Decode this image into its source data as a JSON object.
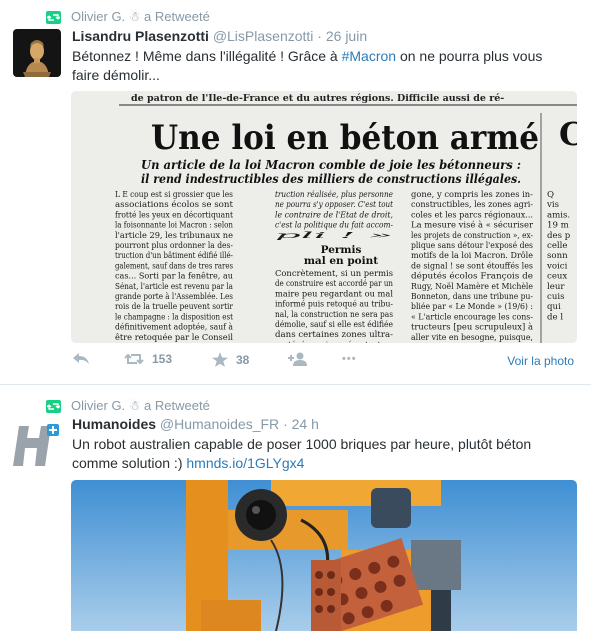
{
  "tweets": [
    {
      "retweet_by": "Olivier G. ☃ a Retweeté",
      "fullname": "Lisandru Plasenzotti",
      "username": "@LisPlasenzotti",
      "separator": "·",
      "time": "26 juin",
      "text_part1": "Bétonnez ! Même dans l'illégalité ! Grâce à ",
      "hashtag": "#Macron",
      "text_part2": " on ne pourra plus vous faire démolir...",
      "media": {
        "top_line": "de patron de l'Ile-de-France et du     autres régions. Difficile aussi de ré-",
        "headline": "Une loi en béton armé",
        "side_letter": "C",
        "subheadline_1": "Un article de la loi Macron comble de joie les bétonneurs :",
        "subheadline_2": "il rend indestructibles des milliers de constructions illégales.",
        "col1": [
          "L E coup est si grossier que les",
          "associations écolos se sont",
          "frotté les yeux en décortiquant",
          "la foisonnante loi Macron : selon",
          "l'article 29, les tribunaux ne",
          "pourront plus ordonner la des-",
          "truction d'un bâtiment édifié illé-",
          "galement, sauf dans de tres rares",
          "cas... Sorti par la fenêtre, au",
          "Sénat, l'article est revenu par la",
          "grande porte à l'Assemblée. Les",
          "rois de la truelle peuvent sortir",
          "le champagne : la disposition est",
          "définitivement adoptée, sauf à",
          "être retoquée par le Conseil"
        ],
        "col2_top": [
          "truction réalisée, plus personne",
          "ne pourra s'y opposer. C'est tout",
          "le contraire de l'Etat de droit,",
          "c'est la politique du fait accom-",
          "pli ! »"
        ],
        "col2_title_1": "Permis",
        "col2_title_2": "mal en point",
        "col2_bottom": [
          "Concrètement, si un permis",
          "de construire est accordé par un",
          "maire peu regardant ou mal",
          "informé puis retoqué au tribu-",
          "nal, la construction ne sera pas",
          "démolie, sauf si elle est édifiée",
          "dans certaines zones ultra-",
          "protégées qui représentent un"
        ],
        "col3": [
          "gone, y compris les zones in-",
          "constructibles, les zones agri-",
          "coles et les parcs régionaux...",
          "La mesure visé à « sécuriser",
          "les projets de construction », ex-",
          "plique sans détour l'exposé des",
          "motifs de la loi Macron. Drôle",
          "de signal ! se sont étouffés les",
          "députés écolos François de",
          "Rugy, Noël Mamère et Michèle",
          "Bonneton, dans une tribune pu-",
          "bliée par « Le Monde » (19/6) :",
          "« L'article encourage les cons-",
          "tructeurs [peu scrupuleux] à",
          "aller vite en besogne, puisque,",
          "une fois la construction achevée,"
        ],
        "col4": [
          "Q",
          "vis",
          "amis.",
          "19 m",
          "des p",
          "celle",
          "sonn",
          "voici",
          "ceux",
          "leur",
          "cuis",
          "qui",
          "de l"
        ]
      },
      "actions": {
        "retweets": "153",
        "favorites": "38",
        "more": "•••",
        "see_photo": "Voir la photo"
      }
    },
    {
      "retweet_by": "Olivier G. ☃ a Retweeté",
      "fullname": "Humanoides",
      "username": "@Humanoides_FR",
      "separator": "·",
      "time": "24 h",
      "text_part1": "Un robot australien capable de poser 1000 briques par heure, plutôt béton comme solution :) ",
      "link": "hmnds.io/1GLYgx4"
    }
  ],
  "colors": {
    "retweet_green": "#19cf86",
    "link_blue": "#2b7bb9",
    "meta_gray": "#8899a6",
    "icon_gray": "#aab8c2",
    "text": "#292f33"
  },
  "icons": {
    "retweet_banner": "retweet-icon",
    "reply": "reply-icon",
    "retweet": "retweet-icon",
    "favorite": "star-icon",
    "follow": "add-user-icon",
    "more": "more-icon"
  }
}
